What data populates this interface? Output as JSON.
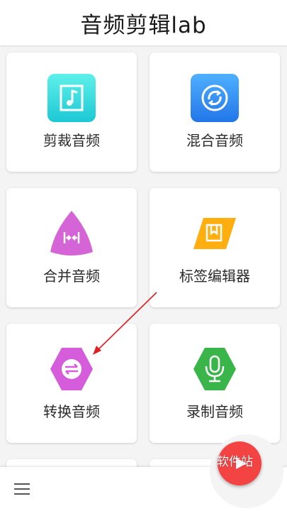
{
  "header": {
    "title": "音频剪辑lab"
  },
  "tiles": [
    {
      "label": "剪裁音频",
      "icon": "music-file-icon",
      "color": "#2ed6cf"
    },
    {
      "label": "混合音频",
      "icon": "merge-circle-icon",
      "color": "#2f8ff2"
    },
    {
      "label": "合并音频",
      "icon": "join-icon",
      "color": "#d564d7"
    },
    {
      "label": "标签编辑器",
      "icon": "tag-bookmark-icon",
      "color": "#ffae0f"
    },
    {
      "label": "转换音频",
      "icon": "convert-arrows-icon",
      "color": "#d55ddb"
    },
    {
      "label": "录制音频",
      "icon": "microphone-icon",
      "color": "#39b54a"
    }
  ],
  "fab": {
    "icon": "play-icon",
    "color": "#f44343"
  },
  "watermark": {
    "text": "软件站"
  },
  "menu": {
    "icon": "hamburger-menu-icon"
  }
}
